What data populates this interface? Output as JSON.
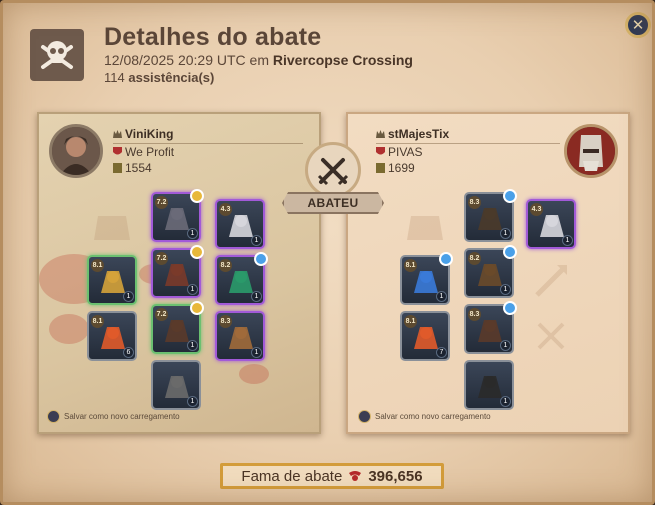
{
  "header": {
    "title": "Detalhes do abate",
    "datetime": "12/08/2025 20:29 UTC",
    "location_prefix": "em",
    "location": "Rivercopse Crossing",
    "assist_count": "114",
    "assist_label": "assistência(s)"
  },
  "killer": {
    "name": "ViniKing",
    "guild": "We Profit",
    "ip": "1554",
    "save_label": "Salvar como novo carregamento"
  },
  "victim": {
    "name": "stMajesTix",
    "guild": "PIVAS",
    "ip": "1699",
    "save_label": "Salvar como novo carregamento"
  },
  "center": {
    "banner_label": "ABATEU",
    "icon": "crossed-swords-icon"
  },
  "killer_equipment": [
    {
      "slot": "head",
      "tier": "7.2",
      "qty": "1",
      "gem": "gold",
      "rarity": "purple",
      "icon": "helmet-icon"
    },
    {
      "slot": "cape",
      "tier": "4.3",
      "qty": "1",
      "gem": "",
      "rarity": "purple",
      "icon": "cape-icon"
    },
    {
      "slot": "weapon",
      "tier": "8.1",
      "qty": "1",
      "gem": "",
      "rarity": "green",
      "icon": "staff-icon"
    },
    {
      "slot": "armor",
      "tier": "7.2",
      "qty": "1",
      "gem": "gold",
      "rarity": "purple",
      "icon": "armor-icon"
    },
    {
      "slot": "offhand",
      "tier": "8.2",
      "qty": "1",
      "gem": "blue",
      "rarity": "purple",
      "icon": "offhand-icon"
    },
    {
      "slot": "potion",
      "tier": "8.1",
      "qty": "6",
      "gem": "",
      "rarity": "gray",
      "icon": "potion-icon"
    },
    {
      "slot": "shoes",
      "tier": "7.2",
      "qty": "1",
      "gem": "gold",
      "rarity": "green",
      "icon": "boots-icon"
    },
    {
      "slot": "food",
      "tier": "8.3",
      "qty": "1",
      "gem": "",
      "rarity": "purple",
      "icon": "food-icon"
    },
    {
      "slot": "mount",
      "tier": "",
      "qty": "1",
      "gem": "",
      "rarity": "gray",
      "icon": "mount-icon"
    }
  ],
  "victim_equipment": [
    {
      "slot": "head",
      "tier": "8.3",
      "qty": "1",
      "gem": "blue",
      "rarity": "gray",
      "icon": "hood-icon"
    },
    {
      "slot": "cape",
      "tier": "4.3",
      "qty": "1",
      "gem": "",
      "rarity": "purple",
      "icon": "cape-icon"
    },
    {
      "slot": "weapon",
      "tier": "8.1",
      "qty": "1",
      "gem": "blue",
      "rarity": "gray",
      "icon": "crossbow-icon"
    },
    {
      "slot": "armor",
      "tier": "8.2",
      "qty": "1",
      "gem": "blue",
      "rarity": "gray",
      "icon": "jacket-icon"
    },
    {
      "slot": "potion",
      "tier": "8.1",
      "qty": "7",
      "gem": "",
      "rarity": "gray",
      "icon": "potion-icon"
    },
    {
      "slot": "shoes",
      "tier": "8.3",
      "qty": "1",
      "gem": "blue",
      "rarity": "gray",
      "icon": "boots-icon"
    },
    {
      "slot": "mount",
      "tier": "",
      "qty": "1",
      "gem": "",
      "rarity": "gray",
      "icon": "panther-mount-icon"
    }
  ],
  "footer": {
    "fame_label": "Fama de abate",
    "fame_value": "396,656"
  },
  "colors": {
    "background": "#e9cfb0",
    "fame_border": "#d39c3a",
    "blood": "#b93c2d"
  }
}
